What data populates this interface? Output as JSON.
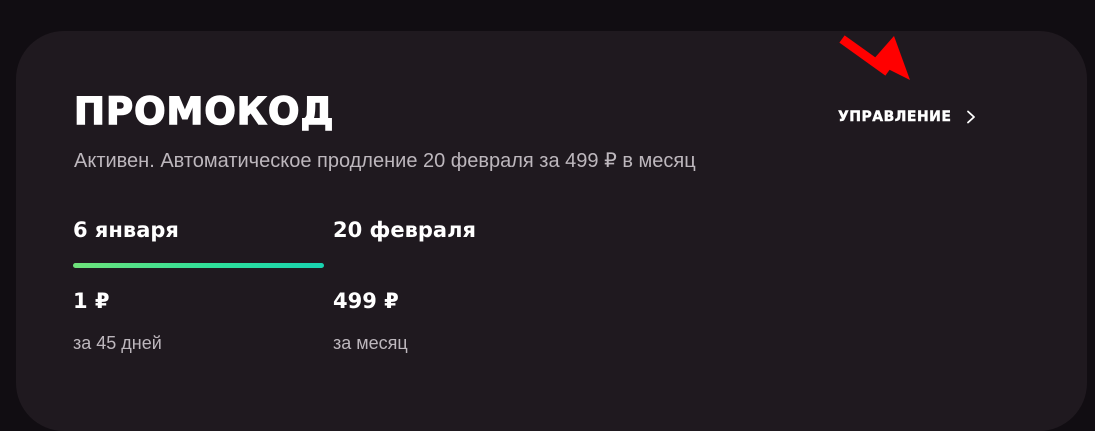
{
  "card": {
    "title": "ПРОМОКОД",
    "manage_label": "УПРАВЛЕНИЕ",
    "status": "Активен. Автоматическое продление 20 февраля за 499 ₽ в месяц"
  },
  "timeline": [
    {
      "date": "6 января",
      "price": "1 ₽",
      "period": "за 45 дней",
      "state": "active"
    },
    {
      "date": "20 февраля",
      "price": "499 ₽",
      "period": "за месяц",
      "state": "upcoming"
    }
  ],
  "colors": {
    "page_background": "#110d12",
    "card_background": "#1f191f",
    "progress_start": "#6fe27a",
    "progress_end": "#18d3b0",
    "annotation_arrow": "#ff0000"
  },
  "icons": {
    "manage": "chevron-right-icon",
    "annotation": "red-arrow-annotation"
  }
}
